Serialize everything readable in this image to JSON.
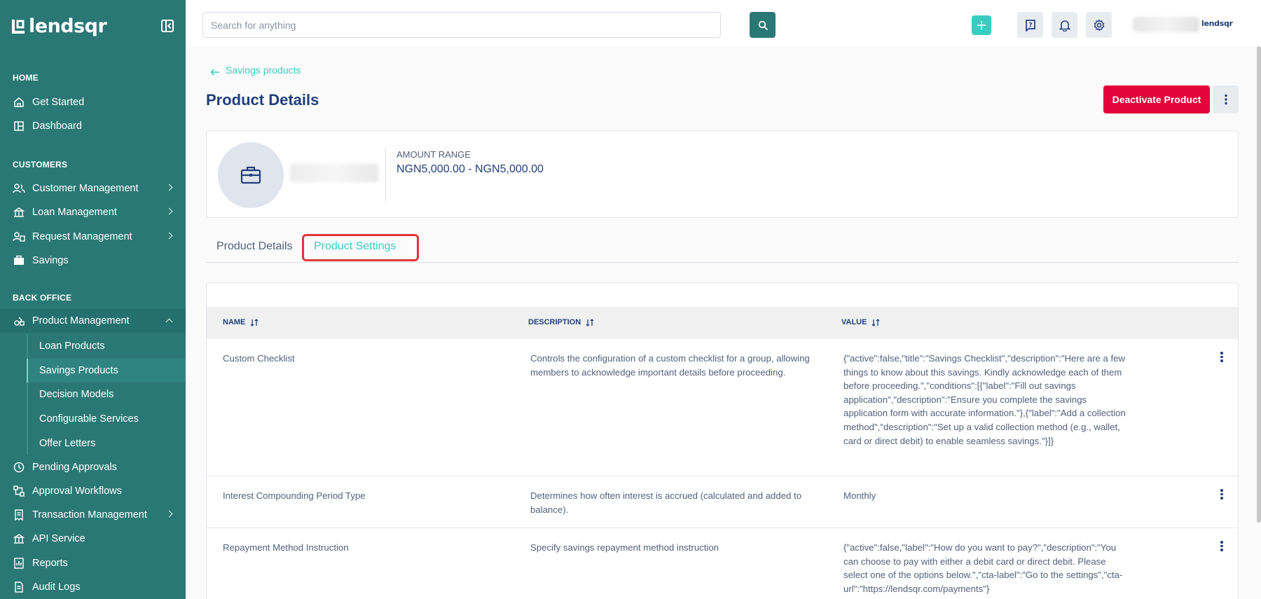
{
  "brand": {
    "name": "lendsqr",
    "mini_name": "lendsqr"
  },
  "colors": {
    "sidebar": "#2a7876",
    "accent": "#39cdc1",
    "danger": "#e4033b",
    "primary_text": "#213f7d"
  },
  "sidebar": {
    "sections": {
      "home": "HOME",
      "customers": "CUSTOMERS",
      "back_office": "BACK OFFICE"
    },
    "items": {
      "get_started": "Get Started",
      "dashboard": "Dashboard",
      "customer_management": "Customer Management",
      "loan_management": "Loan Management",
      "request_management": "Request Management",
      "savings": "Savings",
      "product_management": "Product Management",
      "pending_approvals": "Pending Approvals",
      "approval_workflows": "Approval Workflows",
      "transaction_management": "Transaction Management",
      "api_service": "API Service",
      "reports": "Reports",
      "audit_logs": "Audit Logs"
    },
    "sub_items": {
      "loan_products": "Loan Products",
      "savings_products": "Savings Products",
      "decision_models": "Decision Models",
      "configurable_services": "Configurable Services",
      "offer_letters": "Offer Letters"
    }
  },
  "topbar": {
    "search_placeholder": "Search for anything"
  },
  "breadcrumb": {
    "back_label": "Savings products"
  },
  "page": {
    "title": "Product Details",
    "deactivate_label": "Deactivate Product"
  },
  "product_card": {
    "amount_label": "AMOUNT RANGE",
    "amount_value": "NGN5,000.00 - NGN5,000.00"
  },
  "tabs": {
    "details": "Product Details",
    "settings": "Product Settings"
  },
  "table": {
    "headers": {
      "name": "NAME",
      "description": "DESCRIPTION",
      "value": "VALUE"
    },
    "rows": [
      {
        "name": "Custom Checklist",
        "description": "Controls the configuration of a custom checklist for a group, allowing members to acknowledge important details before proceeding.",
        "value": "{\"active\":false,\"title\":\"Savings Checklist\",\"description\":\"Here are a few things to know about this savings. Kindly acknowledge each of them before proceeding.\",\"conditions\":[{\"label\":\"Fill out savings application\",\"description\":\"Ensure you complete the savings application form with accurate information.\"},{\"label\":\"Add a collection method\",\"description\":\"Set up a valid collection method (e.g., wallet, card or direct debit) to enable seamless savings.\"}]}"
      },
      {
        "name": "Interest Compounding Period Type",
        "description": "Determines how often interest is accrued (calculated and added to balance).",
        "value": "Monthly"
      },
      {
        "name": "Repayment Method Instruction",
        "description": "Specify savings repayment method instruction",
        "value": "{\"active\":false,\"label\":\"How do you want to pay?\",\"description\":\"You can choose to pay with either a debit card or direct debit. Please select one of the options below.\",\"cta-label\":\"Go to the settings\",\"cta-url\":\"https://lendsqr.com/payments\"}"
      }
    ]
  }
}
